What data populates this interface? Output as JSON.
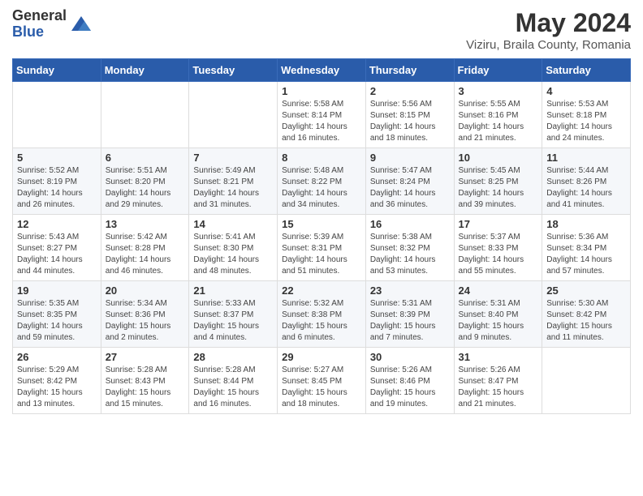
{
  "header": {
    "logo_general": "General",
    "logo_blue": "Blue",
    "month_year": "May 2024",
    "location": "Viziru, Braila County, Romania"
  },
  "days_of_week": [
    "Sunday",
    "Monday",
    "Tuesday",
    "Wednesday",
    "Thursday",
    "Friday",
    "Saturday"
  ],
  "weeks": [
    [
      {
        "day": "",
        "detail": ""
      },
      {
        "day": "",
        "detail": ""
      },
      {
        "day": "",
        "detail": ""
      },
      {
        "day": "1",
        "detail": "Sunrise: 5:58 AM\nSunset: 8:14 PM\nDaylight: 14 hours\nand 16 minutes."
      },
      {
        "day": "2",
        "detail": "Sunrise: 5:56 AM\nSunset: 8:15 PM\nDaylight: 14 hours\nand 18 minutes."
      },
      {
        "day": "3",
        "detail": "Sunrise: 5:55 AM\nSunset: 8:16 PM\nDaylight: 14 hours\nand 21 minutes."
      },
      {
        "day": "4",
        "detail": "Sunrise: 5:53 AM\nSunset: 8:18 PM\nDaylight: 14 hours\nand 24 minutes."
      }
    ],
    [
      {
        "day": "5",
        "detail": "Sunrise: 5:52 AM\nSunset: 8:19 PM\nDaylight: 14 hours\nand 26 minutes."
      },
      {
        "day": "6",
        "detail": "Sunrise: 5:51 AM\nSunset: 8:20 PM\nDaylight: 14 hours\nand 29 minutes."
      },
      {
        "day": "7",
        "detail": "Sunrise: 5:49 AM\nSunset: 8:21 PM\nDaylight: 14 hours\nand 31 minutes."
      },
      {
        "day": "8",
        "detail": "Sunrise: 5:48 AM\nSunset: 8:22 PM\nDaylight: 14 hours\nand 34 minutes."
      },
      {
        "day": "9",
        "detail": "Sunrise: 5:47 AM\nSunset: 8:24 PM\nDaylight: 14 hours\nand 36 minutes."
      },
      {
        "day": "10",
        "detail": "Sunrise: 5:45 AM\nSunset: 8:25 PM\nDaylight: 14 hours\nand 39 minutes."
      },
      {
        "day": "11",
        "detail": "Sunrise: 5:44 AM\nSunset: 8:26 PM\nDaylight: 14 hours\nand 41 minutes."
      }
    ],
    [
      {
        "day": "12",
        "detail": "Sunrise: 5:43 AM\nSunset: 8:27 PM\nDaylight: 14 hours\nand 44 minutes."
      },
      {
        "day": "13",
        "detail": "Sunrise: 5:42 AM\nSunset: 8:28 PM\nDaylight: 14 hours\nand 46 minutes."
      },
      {
        "day": "14",
        "detail": "Sunrise: 5:41 AM\nSunset: 8:30 PM\nDaylight: 14 hours\nand 48 minutes."
      },
      {
        "day": "15",
        "detail": "Sunrise: 5:39 AM\nSunset: 8:31 PM\nDaylight: 14 hours\nand 51 minutes."
      },
      {
        "day": "16",
        "detail": "Sunrise: 5:38 AM\nSunset: 8:32 PM\nDaylight: 14 hours\nand 53 minutes."
      },
      {
        "day": "17",
        "detail": "Sunrise: 5:37 AM\nSunset: 8:33 PM\nDaylight: 14 hours\nand 55 minutes."
      },
      {
        "day": "18",
        "detail": "Sunrise: 5:36 AM\nSunset: 8:34 PM\nDaylight: 14 hours\nand 57 minutes."
      }
    ],
    [
      {
        "day": "19",
        "detail": "Sunrise: 5:35 AM\nSunset: 8:35 PM\nDaylight: 14 hours\nand 59 minutes."
      },
      {
        "day": "20",
        "detail": "Sunrise: 5:34 AM\nSunset: 8:36 PM\nDaylight: 15 hours\nand 2 minutes."
      },
      {
        "day": "21",
        "detail": "Sunrise: 5:33 AM\nSunset: 8:37 PM\nDaylight: 15 hours\nand 4 minutes."
      },
      {
        "day": "22",
        "detail": "Sunrise: 5:32 AM\nSunset: 8:38 PM\nDaylight: 15 hours\nand 6 minutes."
      },
      {
        "day": "23",
        "detail": "Sunrise: 5:31 AM\nSunset: 8:39 PM\nDaylight: 15 hours\nand 7 minutes."
      },
      {
        "day": "24",
        "detail": "Sunrise: 5:31 AM\nSunset: 8:40 PM\nDaylight: 15 hours\nand 9 minutes."
      },
      {
        "day": "25",
        "detail": "Sunrise: 5:30 AM\nSunset: 8:42 PM\nDaylight: 15 hours\nand 11 minutes."
      }
    ],
    [
      {
        "day": "26",
        "detail": "Sunrise: 5:29 AM\nSunset: 8:42 PM\nDaylight: 15 hours\nand 13 minutes."
      },
      {
        "day": "27",
        "detail": "Sunrise: 5:28 AM\nSunset: 8:43 PM\nDaylight: 15 hours\nand 15 minutes."
      },
      {
        "day": "28",
        "detail": "Sunrise: 5:28 AM\nSunset: 8:44 PM\nDaylight: 15 hours\nand 16 minutes."
      },
      {
        "day": "29",
        "detail": "Sunrise: 5:27 AM\nSunset: 8:45 PM\nDaylight: 15 hours\nand 18 minutes."
      },
      {
        "day": "30",
        "detail": "Sunrise: 5:26 AM\nSunset: 8:46 PM\nDaylight: 15 hours\nand 19 minutes."
      },
      {
        "day": "31",
        "detail": "Sunrise: 5:26 AM\nSunset: 8:47 PM\nDaylight: 15 hours\nand 21 minutes."
      },
      {
        "day": "",
        "detail": ""
      }
    ]
  ]
}
